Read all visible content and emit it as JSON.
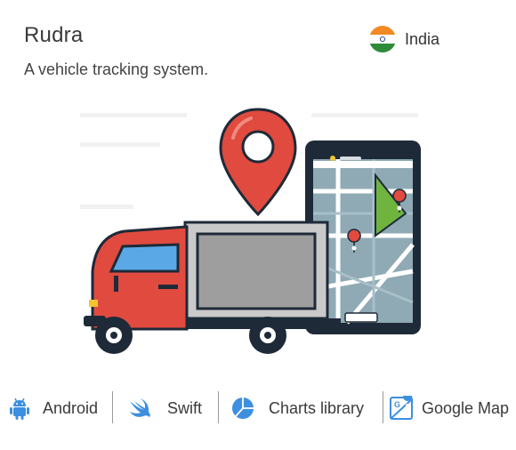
{
  "project": {
    "title": "Rudra",
    "description": "A vehicle tracking system."
  },
  "country": {
    "label": "India",
    "icon": "india-flag-icon"
  },
  "illustration": {
    "icon": "vehicle-tracking-illustration"
  },
  "technologies": [
    {
      "label": "Android",
      "icon": "android-icon",
      "color": "#3d8fe0"
    },
    {
      "label": "Swift",
      "icon": "swift-icon",
      "color": "#3d8fe0"
    },
    {
      "label": "Charts library",
      "icon": "pie-chart-icon",
      "color": "#3d8fe0"
    },
    {
      "label": "Google Map",
      "icon": "google-maps-icon",
      "color": "#3d8fe0"
    }
  ],
  "colors": {
    "accent": "#3d8fe0",
    "pin": "#e04a3f",
    "truck": "#e04a3f",
    "map_green": "#6fb43f",
    "dark": "#1e2a38"
  }
}
